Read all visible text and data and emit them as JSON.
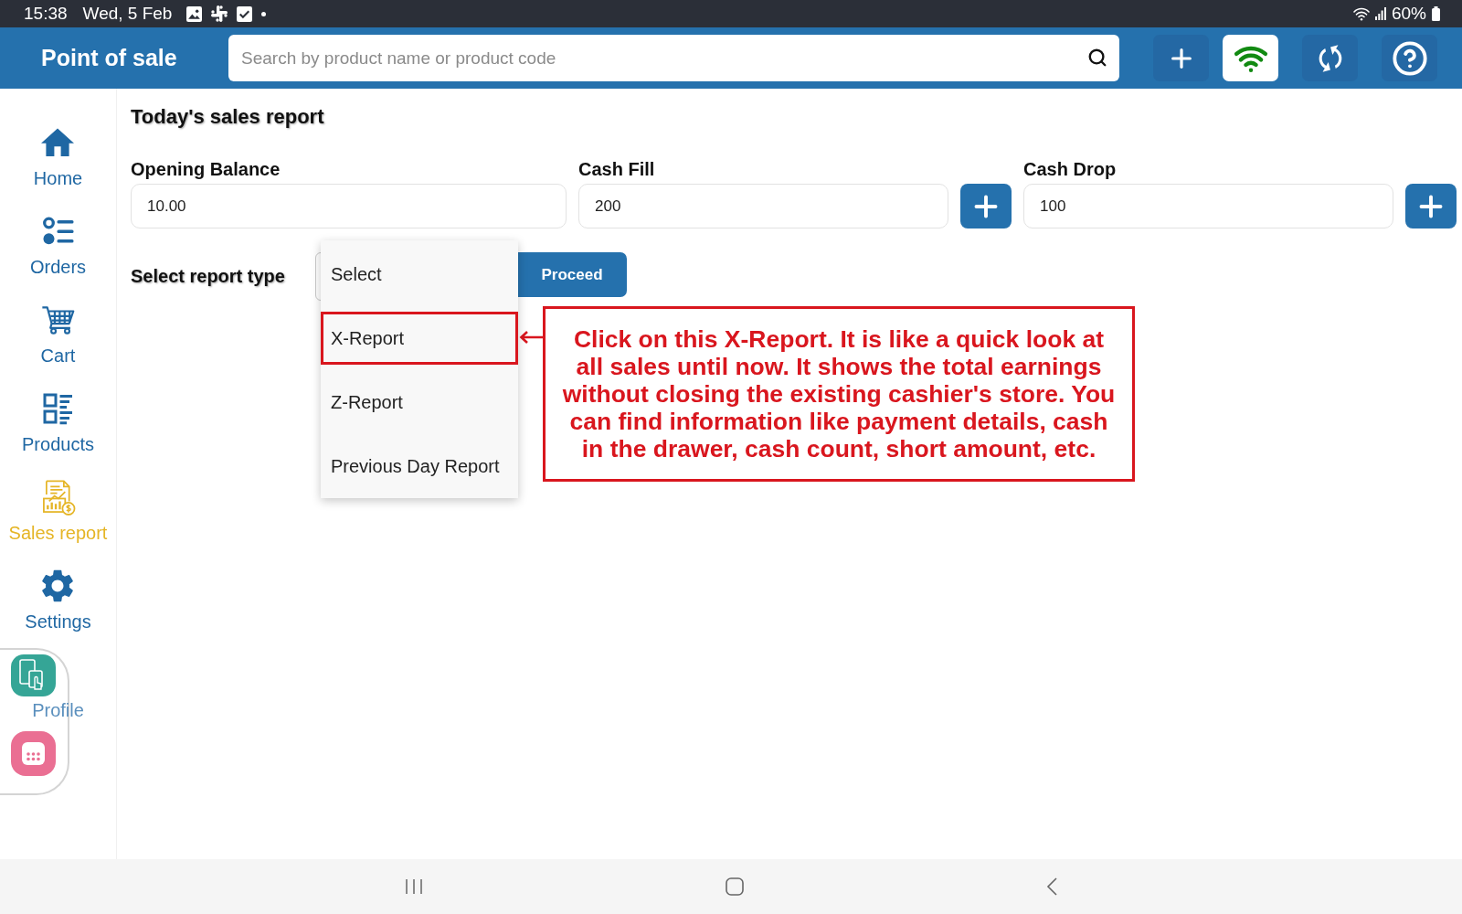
{
  "status_bar": {
    "time": "15:38",
    "date": "Wed, 5 Feb",
    "battery": "60%"
  },
  "header": {
    "title": "Point of sale",
    "search": {
      "placeholder": "Search by product name or product code"
    }
  },
  "sidebar": {
    "items": [
      {
        "label": "Home",
        "selected": false
      },
      {
        "label": "Orders",
        "selected": false
      },
      {
        "label": "Cart",
        "selected": false
      },
      {
        "label": "Products",
        "selected": false
      },
      {
        "label": "Sales report",
        "selected": true
      },
      {
        "label": "Settings",
        "selected": false
      },
      {
        "label": "Profile",
        "selected": false
      }
    ]
  },
  "report": {
    "title": "Today's sales report",
    "fields": [
      {
        "label": "Opening Balance",
        "value": "10.00",
        "kind": "plain"
      },
      {
        "label": "Cash Fill",
        "value": "200",
        "kind": "addable"
      },
      {
        "label": "Cash Drop",
        "value": "100",
        "kind": "addable"
      }
    ],
    "report_type": {
      "label": "Select report type",
      "menu": {
        "items": [
          {
            "label": "Select",
            "selected": false,
            "highlighted": false
          },
          {
            "label": "X-Report",
            "selected": false,
            "highlighted": true
          },
          {
            "label": "Z-Report",
            "selected": false,
            "highlighted": false
          },
          {
            "label": "Previous Day Report",
            "selected": false,
            "highlighted": false
          }
        ]
      },
      "proceed": "Proceed"
    }
  },
  "callout": {
    "text": "Click on this X-Report. It is like a quick look at all sales until now. It shows the total earnings without closing the existing cashier's store. You can find information like payment details, cash in the drawer, cash count, short amount, etc."
  }
}
